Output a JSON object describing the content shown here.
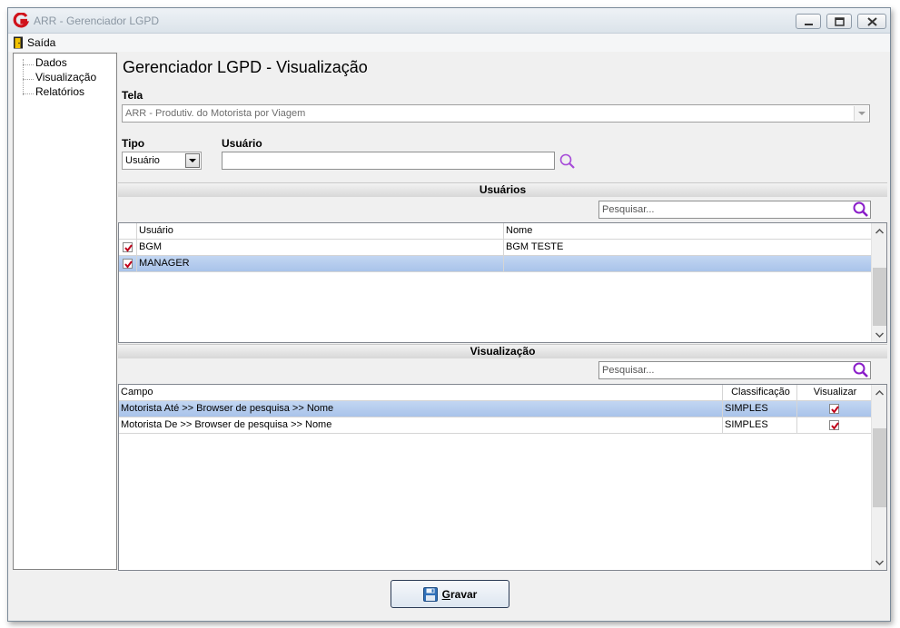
{
  "window": {
    "title": "ARR - Gerenciador LGPD"
  },
  "menu": {
    "exit_label": "Saída"
  },
  "nav": {
    "items": [
      {
        "label": "Dados"
      },
      {
        "label": "Visualização"
      },
      {
        "label": "Relatórios"
      }
    ]
  },
  "page": {
    "title": "Gerenciador LGPD - Visualização"
  },
  "form": {
    "tela_label": "Tela",
    "tela_value": "ARR - Produtiv. do Motorista por Viagem",
    "tipo_label": "Tipo",
    "tipo_value": "Usuário",
    "usuario_label": "Usuário",
    "usuario_value": ""
  },
  "usuarios": {
    "header": "Usuários",
    "search_placeholder": "Pesquisar...",
    "columns": [
      "Usuário",
      "Nome"
    ],
    "rows": [
      {
        "checked": true,
        "usuario": "BGM",
        "nome": "BGM TESTE",
        "selected": false
      },
      {
        "checked": true,
        "usuario": "MANAGER",
        "nome": "",
        "selected": true
      }
    ]
  },
  "visualizacao": {
    "header": "Visualização",
    "search_placeholder": "Pesquisar...",
    "columns": [
      "Campo",
      "Classificação",
      "Visualizar"
    ],
    "rows": [
      {
        "campo": "Motorista Até >> Browser de pesquisa >> Nome",
        "classificacao": "SIMPLES",
        "visualizar": true,
        "selected": true
      },
      {
        "campo": "Motorista De >> Browser de pesquisa >> Nome",
        "classificacao": "SIMPLES",
        "visualizar": true,
        "selected": false
      }
    ]
  },
  "footer": {
    "save_label_mnemonic": "G",
    "save_label_rest": "ravar"
  },
  "colors": {
    "accent_icon": "#9b3fd6",
    "selection": "#b3cbee",
    "check": "#c0001a"
  }
}
